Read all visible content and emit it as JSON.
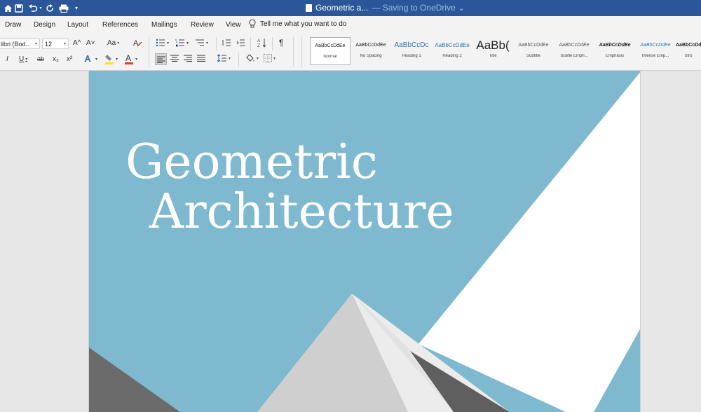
{
  "titlebar": {
    "document_name": "Geometric a...",
    "save_status": "— Saving to OneDrive ⌄",
    "icons": [
      "home-icon",
      "save-icon",
      "undo-icon",
      "redo-icon",
      "print-icon",
      "customize-icon"
    ]
  },
  "tabs": [
    {
      "label": "Draw"
    },
    {
      "label": "Design"
    },
    {
      "label": "Layout"
    },
    {
      "label": "References"
    },
    {
      "label": "Mailings"
    },
    {
      "label": "Review"
    },
    {
      "label": "View"
    }
  ],
  "tell_me": {
    "placeholder": "Tell me what you want to do"
  },
  "font": {
    "name": "libri (Bod...",
    "size": "12"
  },
  "font_tools": {
    "grow": "A^",
    "shrink": "A˅",
    "change_case": "Aa",
    "italic": "I",
    "underline": "U",
    "strikethrough": "ab",
    "subscript": "x₂",
    "superscript": "x²"
  },
  "colors": {
    "titlebar": "#2b579a",
    "page_background": "#7fb9cf",
    "highlight": "#ffe600",
    "font_color": "#e03a2f",
    "mountain_light": "#d9d9d9",
    "mountain_dark": "#6b6b6b"
  },
  "styles_gallery": [
    {
      "sample": "AaBbCcDdEe",
      "name": "Normal",
      "selected": true
    },
    {
      "sample": "AaBbCcDdEe",
      "name": "No Spacing"
    },
    {
      "sample": "AaBbCcDc",
      "name": "Heading 1"
    },
    {
      "sample": "AaBbCcDdEe",
      "name": "Heading 2"
    },
    {
      "sample": "AaBb(",
      "name": "Title"
    },
    {
      "sample": "AaBbCcDdEe",
      "name": "Subtitle"
    },
    {
      "sample": "AaBbCcDdEe",
      "name": "Subtle Emph..."
    },
    {
      "sample": "AaBbCcDdEe",
      "name": "Emphasis"
    },
    {
      "sample": "AaBbCcDdEe",
      "name": "Intense Emp..."
    },
    {
      "sample": "AaBbCcDdEe",
      "name": "Stro"
    }
  ],
  "document": {
    "heading_line1": "Geometric",
    "heading_line2": "Architecture"
  }
}
